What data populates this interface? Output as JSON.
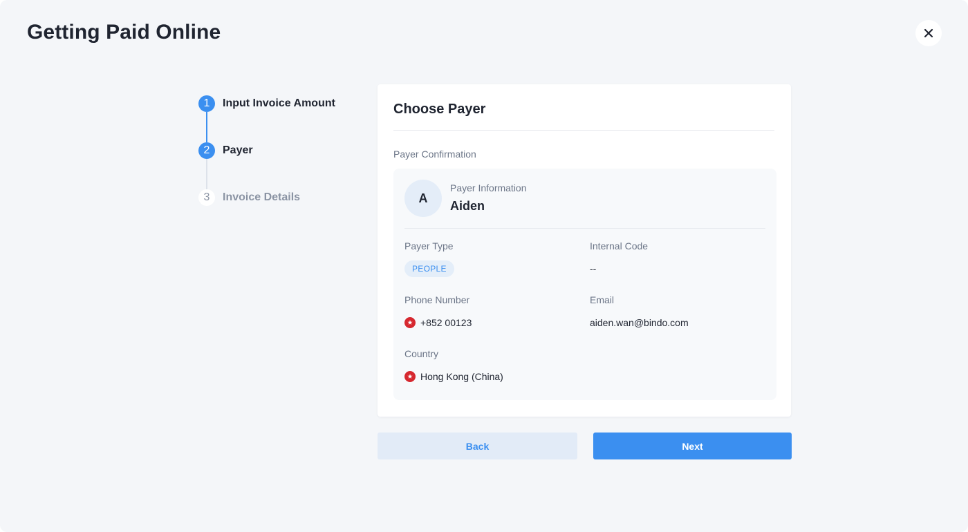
{
  "page": {
    "title": "Getting Paid Online"
  },
  "steps": [
    {
      "number": "1",
      "label": "Input Invoice Amount",
      "state": "done"
    },
    {
      "number": "2",
      "label": "Payer",
      "state": "active"
    },
    {
      "number": "3",
      "label": "Invoice Details",
      "state": "pending"
    }
  ],
  "card": {
    "title": "Choose Payer",
    "section_label": "Payer Confirmation",
    "payer": {
      "avatar_initial": "A",
      "info_label": "Payer Information",
      "name": "Aiden"
    },
    "fields": {
      "payer_type_label": "Payer Type",
      "payer_type_value": "PEOPLE",
      "internal_code_label": "Internal Code",
      "internal_code_value": "--",
      "phone_label": "Phone Number",
      "phone_value": "+852 00123",
      "email_label": "Email",
      "email_value": "aiden.wan@bindo.com",
      "country_label": "Country",
      "country_value": "Hong Kong (China)"
    }
  },
  "buttons": {
    "back": "Back",
    "next": "Next"
  },
  "icons": {
    "close": "close-icon",
    "flag": "hong-kong-flag-icon"
  },
  "colors": {
    "accent": "#3b8ff0",
    "flag_red": "#d6282f"
  }
}
